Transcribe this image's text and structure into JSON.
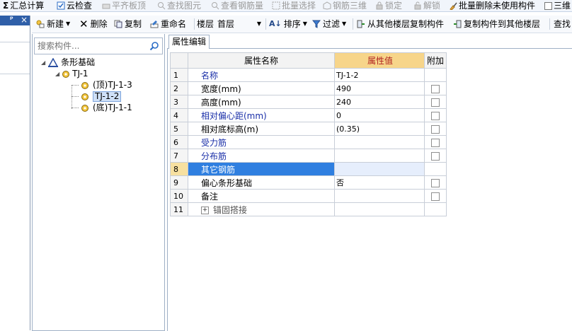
{
  "toolbar": {
    "items": [
      "汇总计算",
      "云检查",
      "平齐板顶",
      "查找图元",
      "查看钢筋量",
      "批量选择",
      "钢筋三维",
      "锁定",
      "解锁",
      "批量删除未使用构件",
      "三维"
    ],
    "sigma": "Σ"
  },
  "toolbar2": {
    "new_label": "新建",
    "delete_label": "删除",
    "copy_label": "复制",
    "rename_label": "重命名",
    "floor_label": "楼层",
    "floor_value": "首层",
    "sort_label": "排序",
    "filter_label": "过滤",
    "copy_from_label": "从其他楼层复制构件",
    "copy_to_label": "复制构件到其他楼层",
    "find_label": "查找"
  },
  "left_pane": {
    "header_pin": "ᵖ",
    "header_close": "×"
  },
  "tree": {
    "search_placeholder": "搜索构件...",
    "root": "条形基础",
    "node": "TJ-1",
    "children": [
      "(顶)TJ-1-3",
      "TJ-1-2",
      "(底)TJ-1-1"
    ],
    "selected_child": 1
  },
  "properties": {
    "tab": "属性编辑",
    "col_name": "属性名称",
    "col_value": "属性值",
    "col_add": "附加",
    "selected_row": 7,
    "rows": [
      {
        "num": "1",
        "name": "名称",
        "value": "TJ-1-2",
        "blue": true,
        "check": false
      },
      {
        "num": "2",
        "name": "宽度(mm)",
        "value": "490",
        "blue": false,
        "check": true
      },
      {
        "num": "3",
        "name": "高度(mm)",
        "value": "240",
        "blue": false,
        "check": true
      },
      {
        "num": "4",
        "name": "相对偏心距(mm)",
        "value": "0",
        "blue": true,
        "check": true
      },
      {
        "num": "5",
        "name": "相对底标高(m)",
        "value": "(0.35)",
        "blue": false,
        "check": true
      },
      {
        "num": "6",
        "name": "受力筋",
        "value": "",
        "blue": true,
        "check": true
      },
      {
        "num": "7",
        "name": "分布筋",
        "value": "",
        "blue": true,
        "check": true
      },
      {
        "num": "8",
        "name": "其它钢筋",
        "value": "",
        "blue": true,
        "check": false
      },
      {
        "num": "9",
        "name": "偏心条形基础",
        "value": "否",
        "blue": false,
        "check": true
      },
      {
        "num": "10",
        "name": "备注",
        "value": "",
        "blue": false,
        "check": true
      },
      {
        "num": "11",
        "name": "锚固搭接",
        "value": "",
        "blue": false,
        "check": false,
        "expand": true
      }
    ]
  },
  "colors": {
    "accent_blue": "#2f7fe0",
    "label_blue": "#1a2fa8",
    "value_header_bg": "#f7d58a",
    "value_header_text": "#b02020"
  }
}
